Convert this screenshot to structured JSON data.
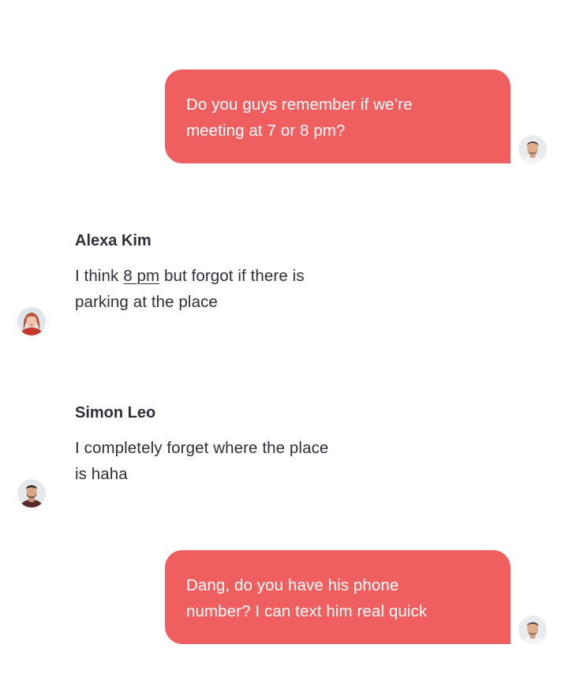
{
  "messages": [
    {
      "kind": "outgoing",
      "text_line1": "Do you guys remember if we’re",
      "text_line2": "meeting at 7 or 8 pm?",
      "avatar_icon": "user-avatar-man-icon"
    },
    {
      "kind": "incoming",
      "sender": "Alexa Kim",
      "text_before_link": "I think ",
      "link_text": "8 pm",
      "text_after_link": " but forgot if there is",
      "text_line2": "parking at the place",
      "avatar_icon": "user-avatar-woman-icon"
    },
    {
      "kind": "incoming",
      "sender": "Simon Leo",
      "text_line1": "I completely forget where the place",
      "text_line2": "is haha",
      "avatar_icon": "user-avatar-man-beard-icon"
    },
    {
      "kind": "outgoing",
      "text_line1": "Dang, do you have his phone",
      "text_line2": "number? I can text him real quick",
      "avatar_icon": "user-avatar-man-icon"
    }
  ],
  "colors": {
    "outgoing_bubble": "#ef5f5f",
    "outgoing_text": "#ffffff",
    "incoming_text": "#2b2f38"
  }
}
